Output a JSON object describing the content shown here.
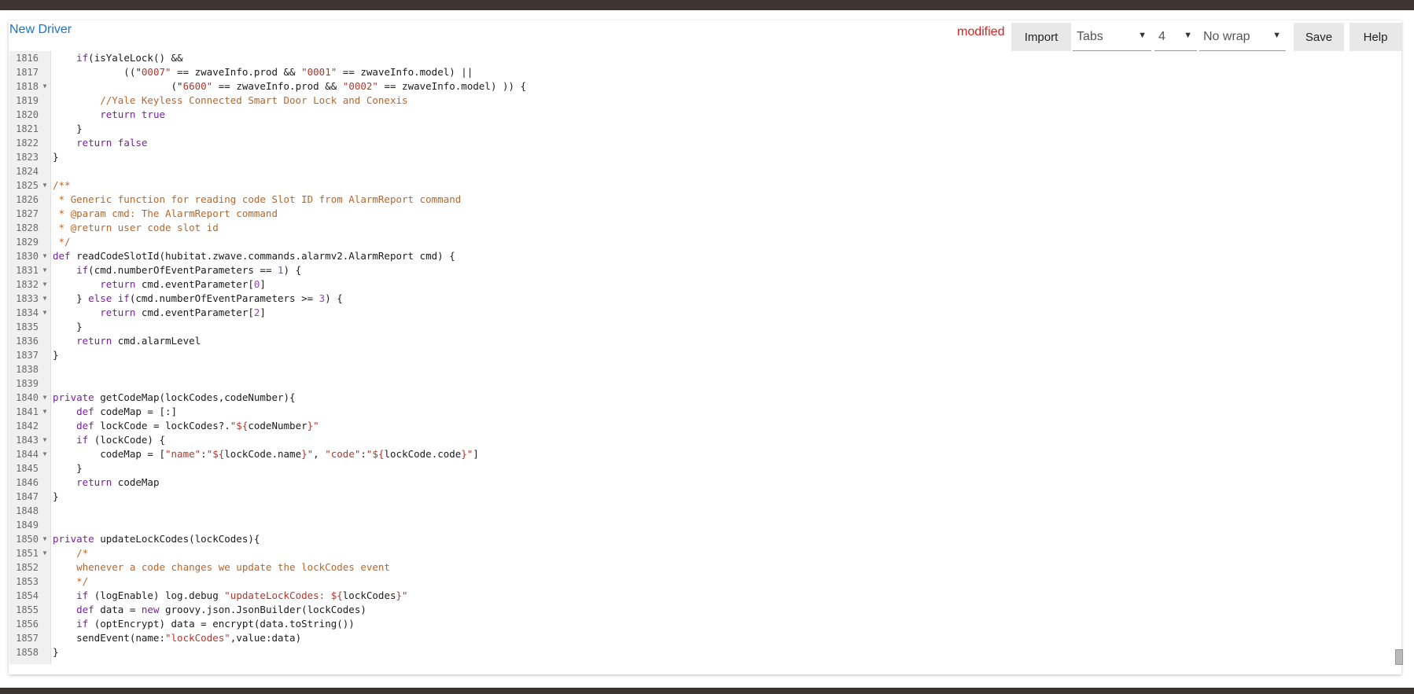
{
  "header": {
    "title": "New Driver",
    "status": "modified",
    "import_label": "Import",
    "indent_type": "Tabs",
    "indent_size": "4",
    "wrap_mode": "No wrap",
    "save_label": "Save",
    "help_label": "Help"
  },
  "colors": {
    "keyword": "#7a1f9c",
    "string": "#b0372c",
    "comment": "#b8662a",
    "number": "#8a48b8",
    "link": "#1a73c6",
    "modified": "#e02020"
  },
  "editor": {
    "lines": [
      {
        "n": "1816",
        "fold": false,
        "tokens": [
          [
            "",
            "    "
          ],
          [
            "kw",
            "if"
          ],
          [
            "",
            "(isYaleLock() &&"
          ]
        ]
      },
      {
        "n": "1817",
        "fold": false,
        "tokens": [
          [
            "",
            "            ((\""
          ],
          [
            "str",
            "0007\""
          ],
          [
            "",
            " == zwaveInfo.prod && "
          ],
          [
            "str",
            "\"0001\""
          ],
          [
            "",
            " == zwaveInfo.model) ||"
          ]
        ]
      },
      {
        "n": "1818",
        "fold": true,
        "tokens": [
          [
            "",
            "                    (\""
          ],
          [
            "str",
            "6600\""
          ],
          [
            "",
            " == zwaveInfo.prod && "
          ],
          [
            "str",
            "\"0002\""
          ],
          [
            "",
            " == zwaveInfo.model) )) {"
          ]
        ]
      },
      {
        "n": "1819",
        "fold": false,
        "tokens": [
          [
            "cm",
            "        //Yale Keyless Connected Smart Door Lock and Conexis"
          ]
        ]
      },
      {
        "n": "1820",
        "fold": false,
        "tokens": [
          [
            "",
            "        "
          ],
          [
            "kw",
            "return true"
          ]
        ]
      },
      {
        "n": "1821",
        "fold": false,
        "tokens": [
          [
            "",
            "    }"
          ]
        ]
      },
      {
        "n": "1822",
        "fold": false,
        "tokens": [
          [
            "",
            "    "
          ],
          [
            "kw",
            "return false"
          ]
        ]
      },
      {
        "n": "1823",
        "fold": false,
        "tokens": [
          [
            "",
            "}"
          ]
        ]
      },
      {
        "n": "1824",
        "fold": false,
        "tokens": [
          [
            "",
            ""
          ]
        ]
      },
      {
        "n": "1825",
        "fold": true,
        "tokens": [
          [
            "cm",
            "/**"
          ]
        ]
      },
      {
        "n": "1826",
        "fold": false,
        "tokens": [
          [
            "cm",
            " * Generic function for reading code Slot ID from AlarmReport command"
          ]
        ]
      },
      {
        "n": "1827",
        "fold": false,
        "tokens": [
          [
            "cm",
            " * @param cmd: The AlarmReport command"
          ]
        ]
      },
      {
        "n": "1828",
        "fold": false,
        "tokens": [
          [
            "cm",
            " * @return user code slot id"
          ]
        ]
      },
      {
        "n": "1829",
        "fold": false,
        "tokens": [
          [
            "cm",
            " */"
          ]
        ]
      },
      {
        "n": "1830",
        "fold": true,
        "tokens": [
          [
            "kw",
            "def"
          ],
          [
            "",
            " readCodeSlotId(hubitat.zwave.commands.alarmv2.AlarmReport cmd) {"
          ]
        ]
      },
      {
        "n": "1831",
        "fold": true,
        "tokens": [
          [
            "",
            "    "
          ],
          [
            "kw",
            "if"
          ],
          [
            "",
            "(cmd.numberOfEventParameters == "
          ],
          [
            "num",
            "1"
          ],
          [
            "",
            ") {"
          ]
        ]
      },
      {
        "n": "1832",
        "fold": true,
        "tokens": [
          [
            "",
            "        "
          ],
          [
            "kw",
            "return"
          ],
          [
            "",
            " cmd.eventParameter["
          ],
          [
            "num",
            "0"
          ],
          [
            "",
            "]"
          ]
        ]
      },
      {
        "n": "1833",
        "fold": true,
        "tokens": [
          [
            "",
            "    } "
          ],
          [
            "kw",
            "else if"
          ],
          [
            "",
            "(cmd.numberOfEventParameters >= "
          ],
          [
            "num",
            "3"
          ],
          [
            "",
            ") {"
          ]
        ]
      },
      {
        "n": "1834",
        "fold": true,
        "tokens": [
          [
            "",
            "        "
          ],
          [
            "kw",
            "return"
          ],
          [
            "",
            " cmd.eventParameter["
          ],
          [
            "num",
            "2"
          ],
          [
            "",
            "]"
          ]
        ]
      },
      {
        "n": "1835",
        "fold": false,
        "tokens": [
          [
            "",
            "    }"
          ]
        ]
      },
      {
        "n": "1836",
        "fold": false,
        "tokens": [
          [
            "",
            "    "
          ],
          [
            "kw",
            "return"
          ],
          [
            "",
            " cmd.alarmLevel"
          ]
        ]
      },
      {
        "n": "1837",
        "fold": false,
        "tokens": [
          [
            "",
            "}"
          ]
        ]
      },
      {
        "n": "1838",
        "fold": false,
        "tokens": [
          [
            "",
            ""
          ]
        ]
      },
      {
        "n": "1839",
        "fold": false,
        "tokens": [
          [
            "",
            ""
          ]
        ]
      },
      {
        "n": "1840",
        "fold": true,
        "tokens": [
          [
            "kw",
            "private"
          ],
          [
            "",
            " getCodeMap(lockCodes,codeNumber){"
          ]
        ]
      },
      {
        "n": "1841",
        "fold": true,
        "tokens": [
          [
            "",
            "    "
          ],
          [
            "kw",
            "def"
          ],
          [
            "",
            " codeMap = [:]"
          ]
        ]
      },
      {
        "n": "1842",
        "fold": false,
        "tokens": [
          [
            "",
            "    "
          ],
          [
            "kw",
            "def"
          ],
          [
            "",
            " lockCode = lockCodes?."
          ],
          [
            "str",
            "\"${"
          ],
          [
            "",
            "codeNumber"
          ],
          [
            "str",
            "}\""
          ]
        ]
      },
      {
        "n": "1843",
        "fold": true,
        "tokens": [
          [
            "",
            "    "
          ],
          [
            "kw",
            "if"
          ],
          [
            "",
            " (lockCode) {"
          ]
        ]
      },
      {
        "n": "1844",
        "fold": true,
        "tokens": [
          [
            "",
            "        codeMap = ["
          ],
          [
            "str",
            "\"name\""
          ],
          [
            "",
            ":"
          ],
          [
            "str",
            "\"${"
          ],
          [
            "",
            "lockCode.name"
          ],
          [
            "str",
            "}\""
          ],
          [
            "",
            ", "
          ],
          [
            "str",
            "\"code\""
          ],
          [
            "",
            ":"
          ],
          [
            "str",
            "\"${"
          ],
          [
            "",
            "lockCode.code"
          ],
          [
            "str",
            "}\""
          ],
          [
            "",
            "]"
          ]
        ]
      },
      {
        "n": "1845",
        "fold": false,
        "tokens": [
          [
            "",
            "    }"
          ]
        ]
      },
      {
        "n": "1846",
        "fold": false,
        "tokens": [
          [
            "",
            "    "
          ],
          [
            "kw",
            "return"
          ],
          [
            "",
            " codeMap"
          ]
        ]
      },
      {
        "n": "1847",
        "fold": false,
        "tokens": [
          [
            "",
            "}"
          ]
        ]
      },
      {
        "n": "1848",
        "fold": false,
        "tokens": [
          [
            "",
            ""
          ]
        ]
      },
      {
        "n": "1849",
        "fold": false,
        "tokens": [
          [
            "",
            ""
          ]
        ]
      },
      {
        "n": "1850",
        "fold": true,
        "tokens": [
          [
            "kw",
            "private"
          ],
          [
            "",
            " updateLockCodes(lockCodes){"
          ]
        ]
      },
      {
        "n": "1851",
        "fold": true,
        "tokens": [
          [
            "cm",
            "    /*"
          ]
        ]
      },
      {
        "n": "1852",
        "fold": false,
        "tokens": [
          [
            "cm",
            "    whenever a code changes we update the lockCodes event"
          ]
        ]
      },
      {
        "n": "1853",
        "fold": false,
        "tokens": [
          [
            "cm",
            "    */"
          ]
        ]
      },
      {
        "n": "1854",
        "fold": false,
        "tokens": [
          [
            "",
            "    "
          ],
          [
            "kw",
            "if"
          ],
          [
            "",
            " (logEnable) log.debug "
          ],
          [
            "str",
            "\"updateLockCodes: ${"
          ],
          [
            "",
            "lockCodes"
          ],
          [
            "str",
            "}\""
          ]
        ]
      },
      {
        "n": "1855",
        "fold": false,
        "tokens": [
          [
            "",
            "    "
          ],
          [
            "kw",
            "def"
          ],
          [
            "",
            " data = "
          ],
          [
            "kw",
            "new"
          ],
          [
            "",
            " groovy.json.JsonBuilder(lockCodes)"
          ]
        ]
      },
      {
        "n": "1856",
        "fold": false,
        "tokens": [
          [
            "",
            "    "
          ],
          [
            "kw",
            "if"
          ],
          [
            "",
            " (optEncrypt) data = encrypt(data.toString())"
          ]
        ]
      },
      {
        "n": "1857",
        "fold": false,
        "tokens": [
          [
            "",
            "    sendEvent(name:"
          ],
          [
            "str",
            "\"lockCodes\""
          ],
          [
            "",
            ",value:data)"
          ]
        ]
      },
      {
        "n": "1858",
        "fold": false,
        "tokens": [
          [
            "",
            "}"
          ]
        ]
      }
    ]
  }
}
